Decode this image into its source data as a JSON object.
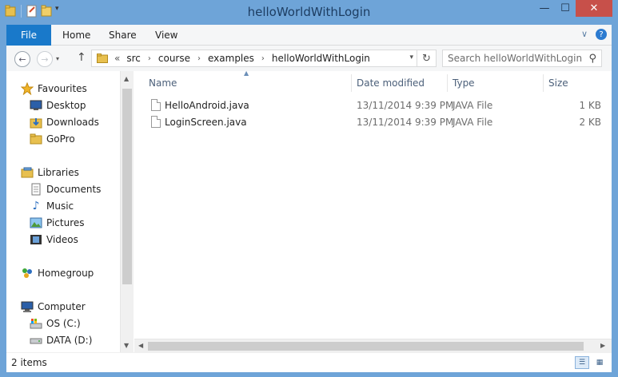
{
  "window": {
    "title": "helloWorldWithLogin",
    "minimize": "—",
    "maximize": "☐",
    "close": "✕"
  },
  "ribbon": {
    "tabs": [
      "File",
      "Home",
      "Share",
      "View"
    ],
    "help": "?",
    "expand": "∨"
  },
  "address": {
    "overflow": "«",
    "breadcrumb": [
      "src",
      "course",
      "examples",
      "helloWorldWithLogin"
    ],
    "search_placeholder": "Search helloWorldWithLogin"
  },
  "nav_pane": {
    "favourites": {
      "label": "Favourites",
      "icon": "star-icon",
      "items": [
        {
          "label": "Desktop",
          "icon": "desktop-icon"
        },
        {
          "label": "Downloads",
          "icon": "downloads-icon"
        },
        {
          "label": "GoPro",
          "icon": "folder-icon"
        }
      ]
    },
    "libraries": {
      "label": "Libraries",
      "icon": "libraries-icon",
      "items": [
        {
          "label": "Documents",
          "icon": "documents-icon"
        },
        {
          "label": "Music",
          "icon": "music-icon"
        },
        {
          "label": "Pictures",
          "icon": "pictures-icon"
        },
        {
          "label": "Videos",
          "icon": "videos-icon"
        }
      ]
    },
    "homegroup": {
      "label": "Homegroup",
      "icon": "homegroup-icon"
    },
    "computer": {
      "label": "Computer",
      "icon": "computer-icon",
      "items": [
        {
          "label": "OS (C:)",
          "icon": "drive-icon"
        },
        {
          "label": "DATA (D:)",
          "icon": "drive-icon"
        }
      ]
    }
  },
  "file_list": {
    "columns": [
      "Name",
      "Date modified",
      "Type",
      "Size"
    ],
    "rows": [
      {
        "name": "HelloAndroid.java",
        "date": "13/11/2014 9:39 PM",
        "type": "JAVA File",
        "size": "1 KB"
      },
      {
        "name": "LoginScreen.java",
        "date": "13/11/2014 9:39 PM",
        "type": "JAVA File",
        "size": "2 KB"
      }
    ]
  },
  "status": {
    "count": "2 items"
  },
  "colors": {
    "frame": "#6ea4d8",
    "file_tab": "#1979ca",
    "close_button": "#c7504a"
  }
}
